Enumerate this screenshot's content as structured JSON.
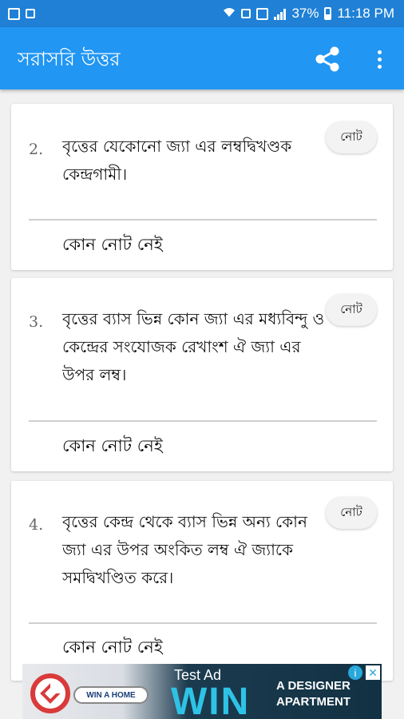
{
  "status_bar": {
    "battery": "37%",
    "time": "11:18 PM"
  },
  "app_bar": {
    "title": "সরাসরি উত্তর",
    "share_icon": "share-icon",
    "more_icon": "more-vert-icon"
  },
  "cards": [
    {
      "number": "2.",
      "text": "বৃত্তের যেকোনো জ্যা এর লম্বদ্বিখণ্ডক কেন্দ্রগামী।",
      "note_button": "নোট",
      "note": "কোন নোট নেই"
    },
    {
      "number": "3.",
      "text": "বৃত্তের ব্যাস ভিন্ন কোন জ্যা এর মধ্যবিন্দু ও কেন্দ্রের সংযোজক রেখাংশ ঐ জ্যা এর উপর লম্ব।",
      "note_button": "নোট",
      "note": "কোন নোট নেই"
    },
    {
      "number": "4.",
      "text": "বৃত্তের কেন্দ্র থেকে ব্যাস ভিন্ন অন্য কোন জ্যা এর উপর অংকিত লম্ব ঐ জ্যাকে সমদ্বিখণ্ডিত করে।",
      "note_button": "নোট",
      "note": "কোন নোট নেই"
    }
  ],
  "ad": {
    "badge": "WIN A HOME",
    "label": "Test Ad",
    "headline": "WIN",
    "subline1": "A DESIGNER",
    "subline2": "APARTMENT"
  },
  "colors": {
    "status_bar": "#1f80d6",
    "app_bar": "#2196f3",
    "background": "#f1f1f1"
  }
}
